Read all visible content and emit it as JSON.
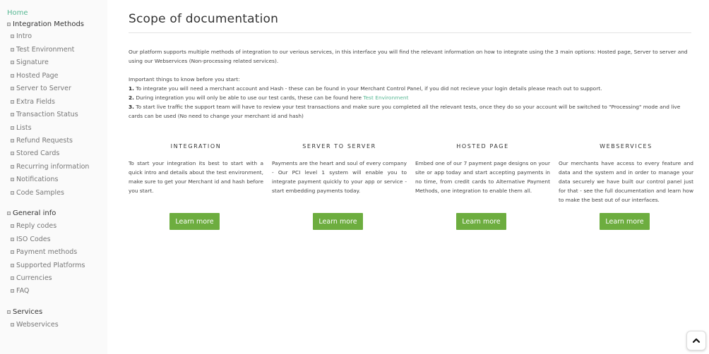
{
  "sidebar": {
    "home": "Home",
    "groups": [
      {
        "label": "Integration Methods",
        "items": [
          "Intro",
          "Test Environment",
          "Signature",
          "Hosted Page",
          "Server to Server",
          "Extra Fields",
          "Transaction Status",
          "Lists",
          "Refund Requests",
          "Stored Cards",
          "Recurring information",
          "Notifications",
          "Code Samples"
        ]
      },
      {
        "label": "General info",
        "items": [
          "Reply codes",
          "ISO Codes",
          "Payment methods",
          "Supported Platforms",
          "Currencies",
          "FAQ"
        ]
      },
      {
        "label": "Services",
        "items": [
          "Webservices"
        ]
      }
    ]
  },
  "main": {
    "title": "Scope of documentation",
    "intro": "Our platform supports multiple methods of integration to our verious services, in this interface you will find the relevant information on how to integrate using the 3 main options: Hosted page, Server to server and using our Webservices (Non-processing related services).",
    "important_heading": "Important things to know before you start:",
    "steps": [
      {
        "num": "1.",
        "text": "To integrate you will need a merchant account and Hash - these can be found in your Merchant Control Panel, if you did not recieve your login details please reach out to support."
      },
      {
        "num": "2.",
        "text": "During integration you will only be able to use our test cards, these can be found here ",
        "link": "Test Environment"
      },
      {
        "num": "3.",
        "text": "To start live traffic the support team will have to review your test transactions and make sure you completed all the relevant tests, once they do so your account will be switched to \"Processing\" mode and live cards can be used (No need to change your merchant id and hash)"
      }
    ],
    "columns": [
      {
        "title": "INTEGRATION",
        "text": "To start your integration its best to start with a quick intro and details about the test environment, make sure to get your Merchant id and hash before you start.",
        "button": "Learn more"
      },
      {
        "title": "SERVER TO SERVER",
        "text": "Payments are the heart and soul of every company - Our PCI level 1 system will enable you to integrate payment quickly to your app or service - start embedding payments today.",
        "button": "Learn more"
      },
      {
        "title": "HOSTED PAGE",
        "text": "Embed one of our 7 payment page designs on your site or app today and start accepting payments in no time, from credit cards to Alternative Payment Methods, one integration to enable them all.",
        "button": "Learn more"
      },
      {
        "title": "WEBSERVICES",
        "text": "Our merchants have access to every feature and data and the system and in order to manage your data securely we have built our control panel just for that - see the full documentation and learn how to make the best out of our interfaces.",
        "button": "Learn more"
      }
    ]
  },
  "icons": {
    "expand": "plus-square-icon",
    "scroll_top": "chevron-up-icon"
  },
  "colors": {
    "accent": "#58b894",
    "button": "#6dad3f"
  }
}
